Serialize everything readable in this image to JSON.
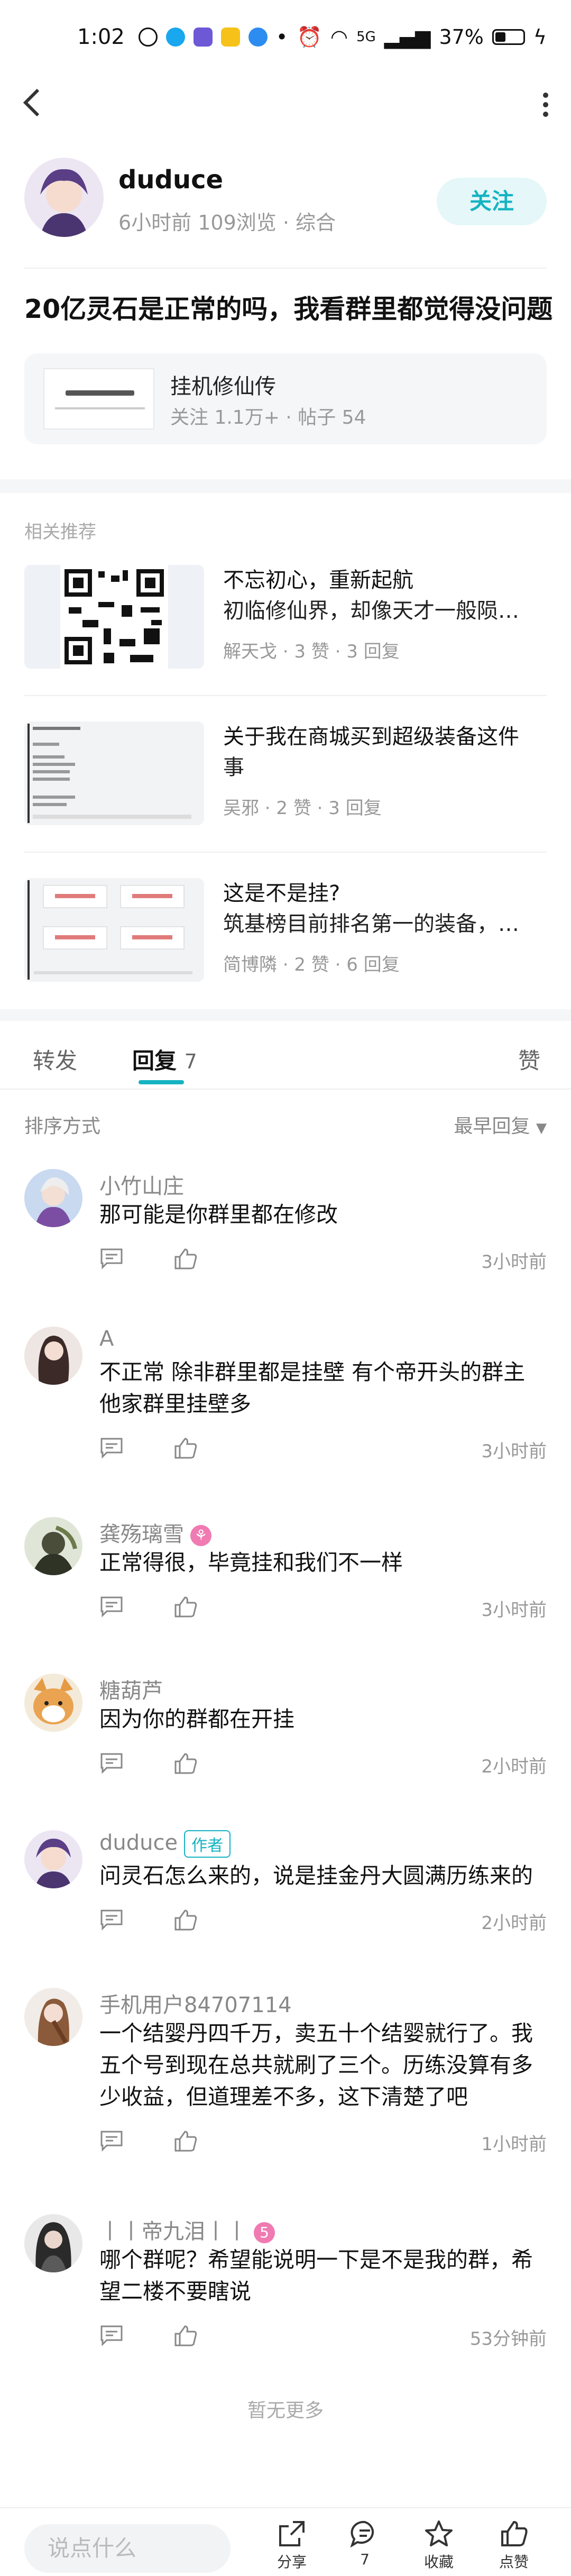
{
  "status_bar": {
    "time": "1:02",
    "battery": "37%",
    "signal": "5G",
    "dot": "•"
  },
  "header": {
    "back_icon": "chevron-left-icon",
    "more_icon": "more-vertical-icon"
  },
  "author": {
    "name": "duduce",
    "meta": "6小时前 109浏览 · 综合",
    "follow_label": "关注"
  },
  "post": {
    "title": "20亿灵石是正常的吗，我看群里都觉得没问题"
  },
  "forum": {
    "name": "挂机修仙传",
    "stats": "关注 1.1万+ · 帖子 54"
  },
  "related": {
    "label": "相关推荐",
    "items": [
      {
        "line1": "不忘初心，重新起航",
        "line2": "初临修仙界，却像天才一般陨…",
        "meta": "解天戈 · 3 赞 · 3 回复"
      },
      {
        "line1": "关于我在商城买到超级装备这件",
        "line2": "事",
        "meta": "吴邪 · 2 赞 · 3 回复"
      },
      {
        "line1": "这是不是挂?",
        "line2": "筑基榜目前排名第一的装备，…",
        "meta": "简博隣 · 2 赞 · 6 回复"
      }
    ]
  },
  "tabs": {
    "forward": "转发",
    "reply": "回复",
    "reply_count": "7",
    "like": "赞"
  },
  "sort": {
    "label": "排序方式",
    "value": "最早回复"
  },
  "comments": [
    {
      "user": "小竹山庄",
      "text": "那可能是你群里都在修改",
      "time": "3小时前"
    },
    {
      "user": "A",
      "text": "不正常 除非群里都是挂壁  有个帝开头的群主他家群里挂壁多",
      "time": "3小时前"
    },
    {
      "user": "龚殇璃雪",
      "text": "正常得很，毕竟挂和我们不一样",
      "time": "3小时前"
    },
    {
      "user": "糖葫芦",
      "text": "因为你的群都在开挂",
      "time": "2小时前"
    },
    {
      "user": "duduce",
      "badge": "作者",
      "text": "问灵石怎么来的，说是挂金丹大圆满历练来的",
      "time": "2小时前"
    },
    {
      "user": "手机用户84707114",
      "text": "一个结婴丹四千万，卖五十个结婴就行了。我五个号到现在总共就刷了三个。历练没算有多少收益，但道理差不多，这下清楚了吧",
      "time": "1小时前"
    },
    {
      "user": "丨丨帝九泪丨丨",
      "text": "哪个群呢？希望能说明一下是不是我的群，希望二楼不要瞎说",
      "time": "53分钟前"
    }
  ],
  "footer": {
    "no_more": "暂无更多"
  },
  "bottom_bar": {
    "placeholder": "说点什么",
    "share": "分享",
    "comment_count": "7",
    "favorite": "收藏",
    "like": "点赞"
  }
}
